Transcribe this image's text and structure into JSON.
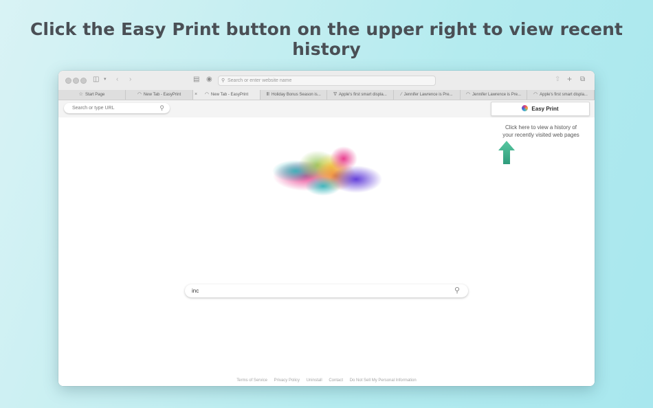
{
  "headline": "Click the Easy Print button on the upper right to view recent history",
  "browser": {
    "address_placeholder": "Search or enter website name",
    "tabs": [
      {
        "label": "Start Page",
        "icon": "star-icon"
      },
      {
        "label": "New Tab - EasyPrint",
        "icon": "easyprint-icon"
      },
      {
        "label": "New Tab - EasyPrint",
        "icon": "easyprint-icon",
        "active": true
      },
      {
        "label": "Holiday Bonus Season is...",
        "icon": "site-icon"
      },
      {
        "label": "Apple's first smart displa...",
        "icon": "site-icon"
      },
      {
        "label": "Jennifer Lawrence is Pre...",
        "icon": "site-icon"
      },
      {
        "label": "Jennifer Lawrence is Pre...",
        "icon": "easyprint-icon"
      },
      {
        "label": "Apple's first smart displa...",
        "icon": "easyprint-icon"
      }
    ]
  },
  "extension": {
    "url_placeholder": "Search or type URL",
    "easy_print_label": "Easy Print",
    "hint_line1": "Click here to view a history of",
    "hint_line2": "your recently visited web pages",
    "arrow_color": "#3dab8a"
  },
  "search": {
    "value": "inc"
  },
  "footer": {
    "links": [
      "Terms of Service",
      "Privacy Policy",
      "Uninstall",
      "Contact",
      "Do Not Sell My Personal Information"
    ]
  }
}
